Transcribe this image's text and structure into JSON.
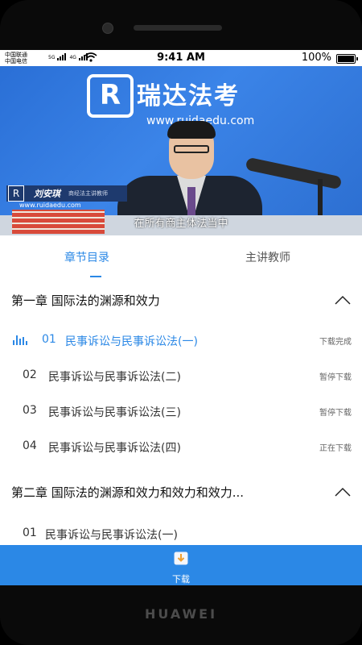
{
  "device": {
    "brand": "HUAWEI"
  },
  "status_bar": {
    "carrier_1": "中国联通",
    "carrier_2": "中国电信",
    "network_1": "5G",
    "network_2": "4G",
    "time": "9:41 AM",
    "battery": "100%"
  },
  "video": {
    "logo_text": "瑞达法考",
    "logo_url": "www.ruidaedu.com",
    "presenter_name": "刘安琪",
    "presenter_title": "商经法主讲教师",
    "book_url": "www.ruidaedu.com",
    "subtitle": "在所有商主体法当中"
  },
  "tabs": [
    {
      "label": "章节目录",
      "active": true
    },
    {
      "label": "主讲教师",
      "active": false
    }
  ],
  "chapters": [
    {
      "title": "第一章   国际法的渊源和效力",
      "expanded": true,
      "lessons": [
        {
          "num": "01",
          "title": "民事诉讼与民事诉讼法(一)",
          "status": "下载完成",
          "playing": true
        },
        {
          "num": "02",
          "title": "民事诉讼与民事诉讼法(二)",
          "status": "暂停下载",
          "playing": false
        },
        {
          "num": "03",
          "title": "民事诉讼与民事诉讼法(三)",
          "status": "暂停下载",
          "playing": false
        },
        {
          "num": "04",
          "title": "民事诉讼与民事诉讼法(四)",
          "status": "正在下载",
          "playing": false
        }
      ]
    },
    {
      "title": "第二章   国际法的渊源和效力和效力和效力...",
      "expanded": true,
      "lessons": [
        {
          "num": "01",
          "title": "民事诉讼与民事诉讼法(一)",
          "status": "",
          "playing": false
        }
      ]
    }
  ],
  "bottom_bar": {
    "download_label": "下载",
    "icon": "download-icon"
  },
  "colors": {
    "accent": "#2b88e6",
    "text": "#333333",
    "status_text": "#666666"
  }
}
